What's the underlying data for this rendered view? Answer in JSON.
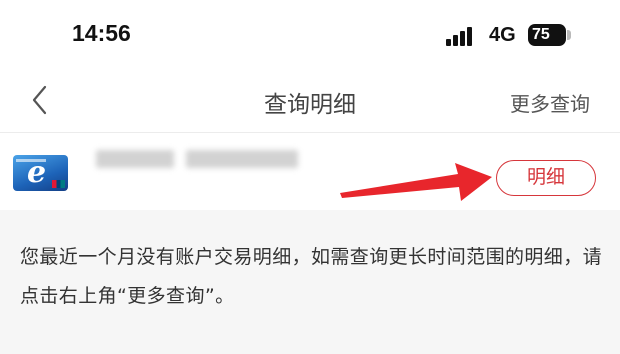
{
  "status_bar": {
    "time": "14:56",
    "network": "4G",
    "battery": "75"
  },
  "nav": {
    "title": "查询明细",
    "more_query": "更多查询"
  },
  "account": {
    "detail_button": "明细",
    "arrow_color": "#e8262c"
  },
  "message": "您最近一个月没有账户交易明细，如需查询更长时间范围的明细，请点击右上角“更多查询”。",
  "colors": {
    "accent": "#d6363b",
    "background": "#f6f6f6"
  }
}
